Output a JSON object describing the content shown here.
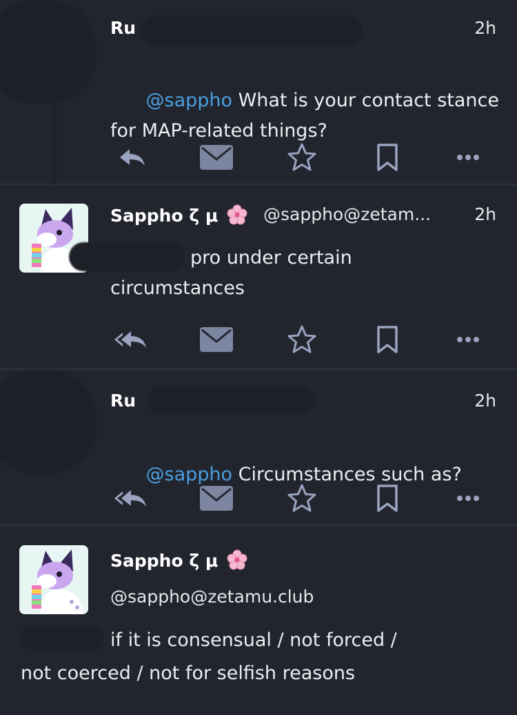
{
  "posts": [
    {
      "author": "Ru",
      "time": "2h",
      "mention": "@sappho",
      "text": " What is your contact stance\nfor MAP-related things?"
    },
    {
      "author": "Sappho ζ μ",
      "handle": "@sappho@zetam...",
      "time": "2h",
      "text": "pro under certain\ncircumstances"
    },
    {
      "author": "Ru",
      "time": "2h",
      "mention": "@sappho",
      "text": " Circumstances such as?"
    },
    {
      "author": "Sappho ζ μ",
      "handle": "@sappho@zetamu.club",
      "text_line1": "if it is consensual / not forced /",
      "text_line2": "not coerced / not for selfish reasons"
    }
  ],
  "icons": {
    "reply": "reply-icon",
    "reply_all": "reply-all-icon",
    "direct_message": "envelope-icon",
    "favourite": "star-icon",
    "bookmark": "bookmark-icon",
    "more": "more-icon",
    "emoji": "cherry-blossom-icon"
  },
  "colors": {
    "background": "#22252e",
    "mention": "#4a9fe0",
    "icon": "#9aa3bf",
    "avatar_bg": "#e8f6f3"
  }
}
